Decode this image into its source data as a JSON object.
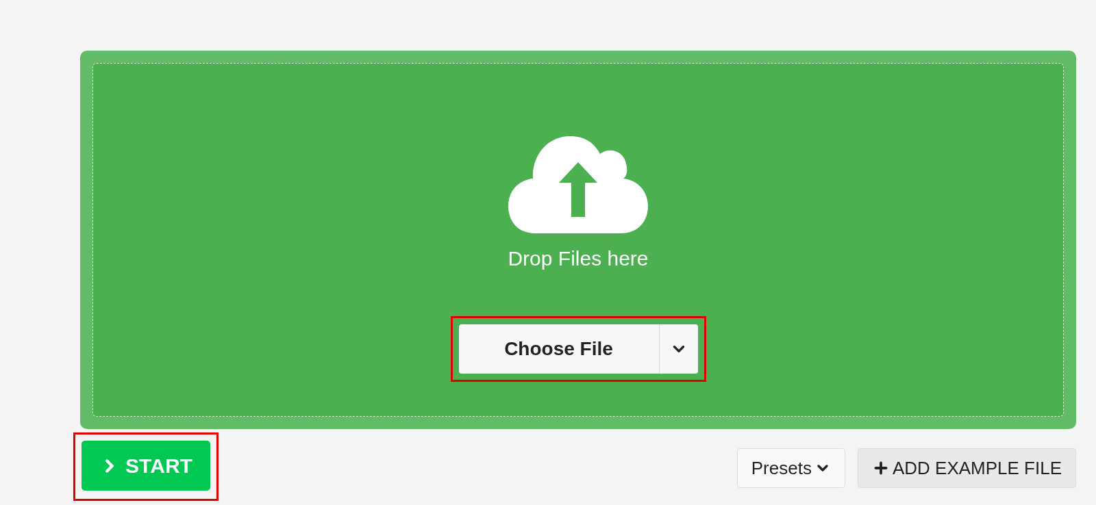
{
  "dropzone": {
    "label": "Drop Files here",
    "choose_file": {
      "label": "Choose File",
      "highlighted": true
    }
  },
  "start_button": {
    "label": "START",
    "highlighted": true
  },
  "presets_button": {
    "label": "Presets"
  },
  "add_example_button": {
    "label": "ADD EXAMPLE FILE"
  }
}
